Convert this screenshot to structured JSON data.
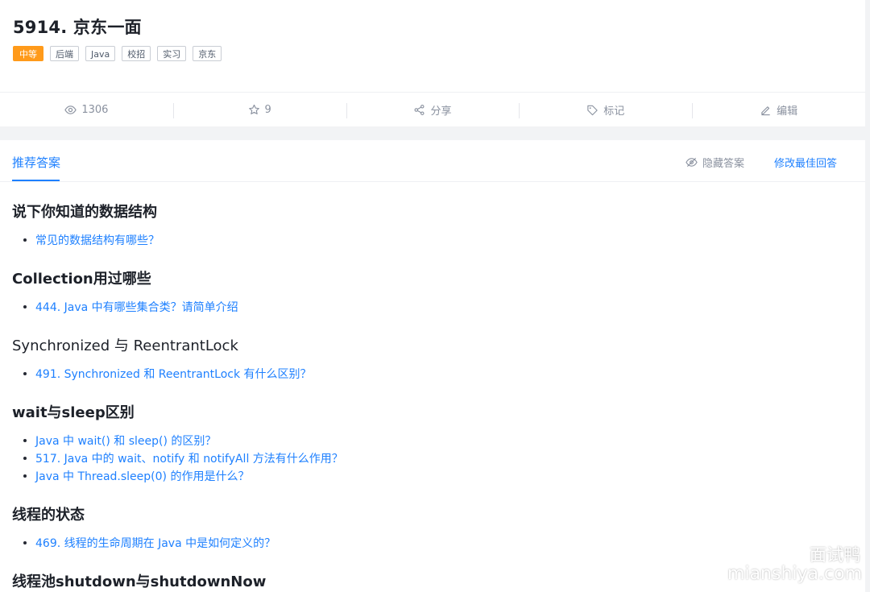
{
  "question": {
    "title": "5914. 京东一面",
    "difficulty": "中等",
    "tags": [
      "后端",
      "Java",
      "校招",
      "实习",
      "京东"
    ]
  },
  "stats": {
    "views": "1306",
    "stars": "9",
    "share": "分享",
    "mark": "标记",
    "edit": "编辑"
  },
  "answer_tabs": {
    "active_tab": "推荐答案",
    "hide_answer": "隐藏答案",
    "edit_best": "修改最佳回答"
  },
  "sections": [
    {
      "heading": "说下你知道的数据结构",
      "links": [
        "常见的数据结构有哪些？"
      ]
    },
    {
      "heading": "Collection用过哪些",
      "links": [
        "444. Java 中有哪些集合类？请简单介绍"
      ]
    },
    {
      "heading": "Synchronized 与 ReentrantLock",
      "links": [
        "491. Synchronized 和 ReentrantLock 有什么区别？"
      ]
    },
    {
      "heading": "wait与sleep区别",
      "links": [
        "Java 中 wait() 和 sleep() 的区别？",
        "517. Java 中的 wait、notify 和 notifyAll 方法有什么作用？",
        "Java 中 Thread.sleep(0) 的作用是什么？"
      ]
    },
    {
      "heading": "线程的状态",
      "links": [
        "469. 线程的生命周期在 Java 中是如何定义的？"
      ]
    },
    {
      "heading": "线程池shutdown与shutdownNow",
      "links": []
    }
  ],
  "watermark": {
    "cn": "面试鸭",
    "en": "mianshiya.com"
  },
  "colors": {
    "accent": "#1e80ff",
    "difficulty_badge": "#ff9a1a",
    "muted": "#8a919f"
  },
  "icons": [
    "eye-icon",
    "star-icon",
    "share-icon",
    "tag-icon",
    "pencil-icon",
    "eye-off-icon"
  ]
}
